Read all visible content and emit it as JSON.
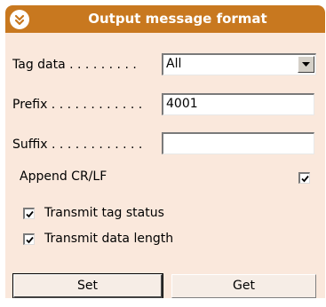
{
  "panel": {
    "title": "Output message format"
  },
  "fields": {
    "tag_data_label": "Tag data . . . . . . . . .",
    "tag_data_value": "All",
    "prefix_label": "Prefix . . . . . . . . . . . .",
    "prefix_value": "4001",
    "suffix_label": "Suffix . . . . . . . . . . . .",
    "suffix_value": ""
  },
  "options": {
    "append_crlf_label": "Append CR/LF",
    "append_crlf_checked": true,
    "transmit_tag_status_label": "Transmit tag status",
    "transmit_tag_status_checked": true,
    "transmit_data_length_label": "Transmit data length",
    "transmit_data_length_checked": true
  },
  "buttons": {
    "set_label": "Set",
    "get_label": "Get"
  },
  "colors": {
    "header": "#c8781f",
    "panel_bg": "#fae8dc"
  },
  "icons": {
    "collapse": "chevron-double-down-icon",
    "dropdown": "triangle-down-icon",
    "check": "checkmark-icon"
  }
}
